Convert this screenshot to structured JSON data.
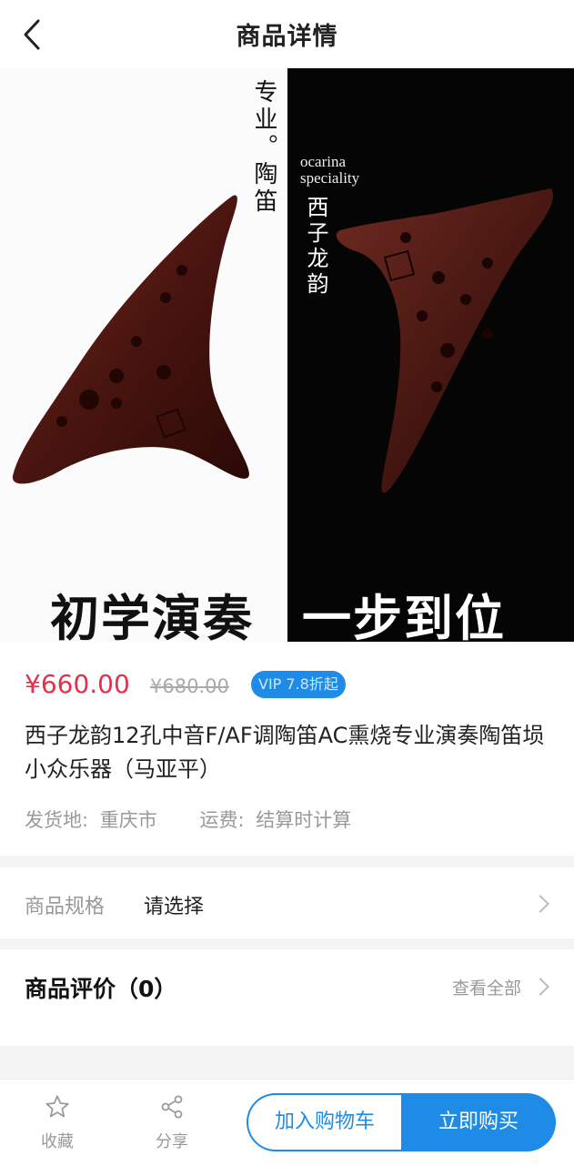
{
  "header": {
    "title": "商品详情",
    "back_icon": "chevron-left-icon"
  },
  "banner": {
    "left_vertical_text": "专业。陶笛",
    "right_latin_line1": "ocarina",
    "right_latin_line2": "speciality",
    "right_vertical_text": "西子龙韵",
    "slogan_left": "初学演奏",
    "slogan_right": "一步到位",
    "active_slide": 1,
    "accent_color": "#1e8ce6"
  },
  "product": {
    "price": "¥660.00",
    "old_price": "¥680.00",
    "vip_badge": "VIP 7.8折起",
    "name": "西子龙韵12孔中音F/AF调陶笛AC熏烧专业演奏陶笛埙小众乐器（马亚平）",
    "ship_from_label": "发货地:",
    "ship_from_value": "重庆市",
    "freight_label": "运费:",
    "freight_value": "结算时计算",
    "price_color": "#e2304d"
  },
  "spec": {
    "label": "商品规格",
    "value": "请选择"
  },
  "review": {
    "title": "商品评价（0）",
    "view_all": "查看全部"
  },
  "bottom_bar": {
    "favorite_label": "收藏",
    "favorite_icon": "star-icon",
    "share_label": "分享",
    "share_icon": "share-icon",
    "add_to_cart": "加入购物车",
    "buy_now": "立即购买"
  }
}
